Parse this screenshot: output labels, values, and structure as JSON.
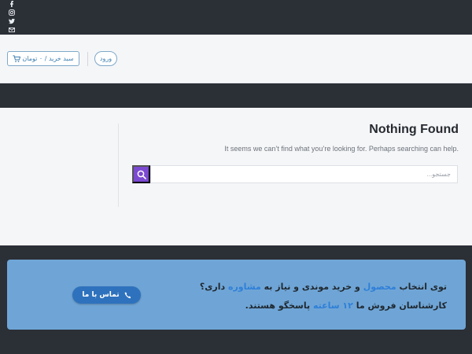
{
  "topbar": {
    "social_icons": [
      "facebook-icon",
      "instagram-icon",
      "twitter-icon",
      "email-icon"
    ]
  },
  "header": {
    "cart_label": "سبد خرید / ۰ تومان",
    "login_label": "ورود"
  },
  "main": {
    "title": "Nothing Found",
    "message": "It seems we can’t find what you’re looking for. Perhaps searching can help.",
    "search_placeholder": "جستجو..."
  },
  "cta": {
    "line1_part1": "توی انتخاب ",
    "line1_highlight1": "محصول",
    "line1_part2": " و خرید موندی و نیاز به ",
    "line1_highlight2": "مشاوره",
    "line1_part3": " داری؟",
    "line2_part1": "کارشناسان فروش ما ",
    "line2_highlight": "۱۲ ساعته",
    "line2_part2": " پاسخگو هستند.",
    "contact_label": "تماس با ما"
  },
  "colors": {
    "dark_bg": "#2b2f36",
    "light_bg": "#f5f6f8",
    "accent_purple": "#7b4ad1",
    "cta_bg": "#6fa5d6",
    "cta_button": "#2e72bd",
    "link_blue": "#3f7fb0"
  }
}
